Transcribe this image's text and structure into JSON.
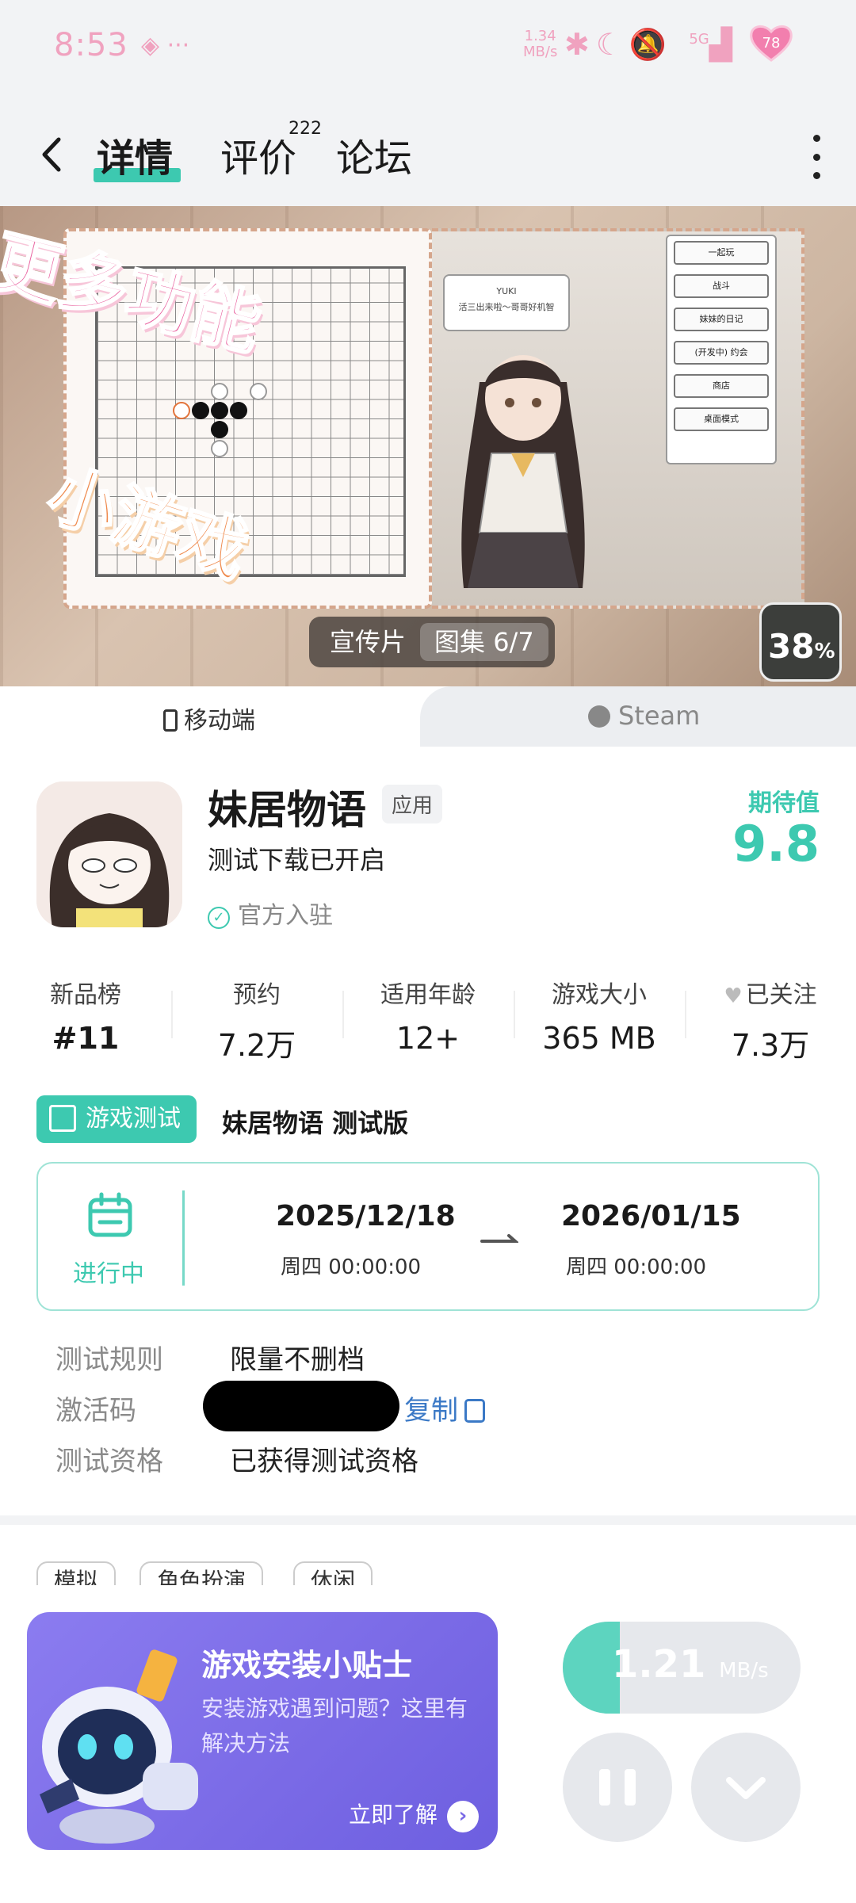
{
  "status_bar": {
    "time": "8:53",
    "left_icons": "◈ ···",
    "net_speed_value": "1.34",
    "net_speed_unit": "MB/s",
    "signal_label": "5G",
    "battery": "78"
  },
  "nav": {
    "tabs": [
      {
        "label": "详情"
      },
      {
        "label": "评价",
        "badge": "222"
      },
      {
        "label": "论坛"
      }
    ]
  },
  "hero": {
    "promo_line_1": "更多功能",
    "promo_line_2": "小游戏",
    "dialog_name": "YUKI",
    "dialog_text": "活三出来啦～哥哥好机智",
    "menu_items": [
      "一起玩",
      "战斗",
      "妹妹的日记",
      "(开发中) 约会",
      "商店",
      "桌面模式"
    ],
    "controls": [
      {
        "label": "宣传片"
      },
      {
        "label": "图集 6/7"
      }
    ],
    "progress_value": "38",
    "progress_unit": "%"
  },
  "platform_tabs": {
    "mobile": "移动端",
    "steam": "Steam"
  },
  "app": {
    "name": "妹居物语",
    "tag": "应用",
    "subtitle": "测试下载已开启",
    "official": "官方入驻",
    "expect_label": "期待值",
    "expect_value": "9.8"
  },
  "stats": [
    {
      "label": "新品榜",
      "value": "#11"
    },
    {
      "label": "预约",
      "value": "7.2万"
    },
    {
      "label": "适用年龄",
      "value": "12+"
    },
    {
      "label": "游戏大小",
      "value": "365 MB"
    },
    {
      "label": "已关注",
      "value": "7.3万"
    }
  ],
  "test": {
    "badge": "游戏测试",
    "name": "妹居物语 测试版",
    "status": "进行中",
    "start_date": "2025/12/18",
    "start_sub": "周四  00:00:00",
    "end_date": "2026/01/15",
    "end_sub": "周四  00:00:00",
    "rows": [
      {
        "label": "测试规则",
        "value": "限量不删档"
      },
      {
        "label": "激活码",
        "value": ""
      },
      {
        "label": "测试资格",
        "value": "已获得测试资格"
      }
    ],
    "copy_label": "复制"
  },
  "tags": [
    "模拟",
    "角色扮演",
    "休闲"
  ],
  "tips": {
    "title": "游戏安装小贴士",
    "desc": "安装游戏遇到问题？这里有解决方法",
    "link": "立即了解"
  },
  "download": {
    "speed": "1.21",
    "unit": "MB/s",
    "progress_fraction": 0.24
  },
  "colors": {
    "accent": "#3dc9b0",
    "link": "#3b79c6",
    "tips_bg": "#7a6ae6"
  }
}
